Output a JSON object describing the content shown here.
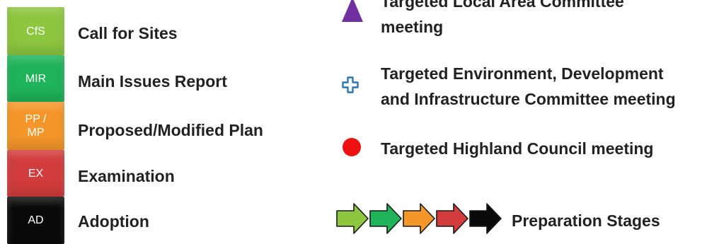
{
  "stages": [
    {
      "code": "CfS",
      "label": "Call for Sites",
      "color": "#8dc63f"
    },
    {
      "code": "MIR",
      "label": "Main Issues Report",
      "color": "#1fb35a"
    },
    {
      "code": "PP /\nMP",
      "label": "Proposed/Modified Plan",
      "color": "#f5962a"
    },
    {
      "code": "EX",
      "label": "Examination",
      "color": "#d23c3c"
    },
    {
      "code": "AD",
      "label": "Adoption",
      "color": "#0a0a0a"
    }
  ],
  "legend": {
    "local_area": {
      "lines": [
        "Targeted Local Area Committee",
        "meeting"
      ],
      "icon": "purple-triangle-icon",
      "color": "#7030a0"
    },
    "edi": {
      "lines": [
        "Targeted Environment, Development",
        "and Infrastructure Committee meeting"
      ],
      "icon": "blue-cross-icon",
      "color": "#2e75b6"
    },
    "council": {
      "lines": [
        "Targeted Highland Council meeting"
      ],
      "icon": "red-circle-icon",
      "color": "#ee1111"
    },
    "preparation": {
      "label": "Preparation Stages",
      "icon": "arrow-sequence-icon",
      "arrow_colors": [
        "#8dc63f",
        "#1fb35a",
        "#f5962a",
        "#d23c3c",
        "#0a0a0a"
      ]
    }
  }
}
